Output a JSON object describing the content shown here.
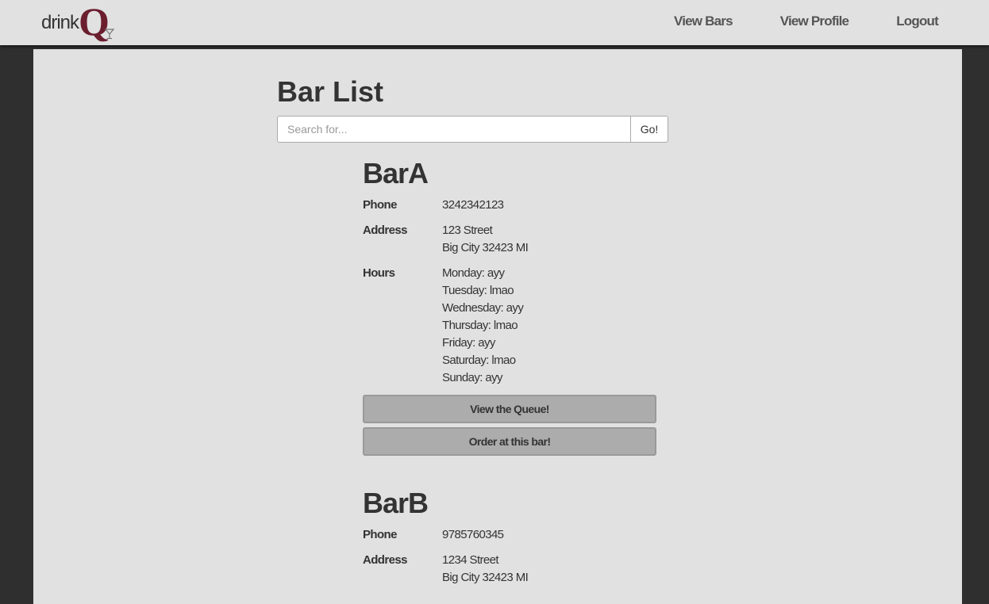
{
  "brand": {
    "prefix": "drink",
    "letter": "Q"
  },
  "nav": {
    "items": [
      {
        "label": "View Bars"
      },
      {
        "label": "View Profile"
      },
      {
        "label": "Logout"
      }
    ]
  },
  "main": {
    "title": "Bar List",
    "search": {
      "placeholder": "Search for...",
      "value": "",
      "button_label": "Go!"
    }
  },
  "labels": {
    "phone": "Phone",
    "address": "Address",
    "hours": "Hours"
  },
  "bars": [
    {
      "name": "BarA",
      "phone": "3242342123",
      "address_line1": "123 Street",
      "address_line2": "Big City 32423 MI",
      "hours": [
        "Monday: ayy",
        "Tuesday: lmao",
        "Wednesday: ayy",
        "Thursday: lmao",
        "Friday: ayy",
        "Saturday: lmao",
        "Sunday: ayy"
      ],
      "queue_button": "View the Queue!",
      "order_button": "Order at this bar!"
    },
    {
      "name": "BarB",
      "phone": "9785760345",
      "address_line1": "1234 Street",
      "address_line2": "Big City 32423 MI"
    }
  ],
  "colors": {
    "brand_accent": "#6b1e2e",
    "page_background": "#e1e1e1",
    "outer_background": "#2f2f2f",
    "button_background": "#acacac"
  }
}
